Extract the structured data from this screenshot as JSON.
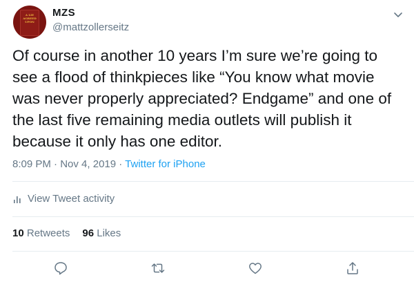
{
  "tweet": {
    "avatar_text": "A LIE AGREED UPON",
    "display_name": "MZS",
    "handle": "@mattzollerseitz",
    "text": "Of course in another 10 years I’m sure we’re going to\nsee a flood of thinkpieces like “You know what movie\nwas never properly appreciated? Endgame” and one of\nthe last five remaining media outlets will publish it\nbecause it only has one editor.",
    "time": "8:09 PM",
    "separator": " · ",
    "date": "Nov 4, 2019",
    "source": "Twitter for iPhone"
  },
  "activity": {
    "label": "View Tweet activity"
  },
  "stats": {
    "retweets_count": "10",
    "retweets_label": "Retweets",
    "likes_count": "96",
    "likes_label": "Likes"
  },
  "actions": [
    "reply-icon",
    "retweet-icon",
    "like-icon",
    "share-icon"
  ],
  "colors": {
    "text": "#14171a",
    "muted": "#657786",
    "link": "#1da1f2",
    "divider": "#e6ecf0",
    "avatar": "#7a1410"
  }
}
